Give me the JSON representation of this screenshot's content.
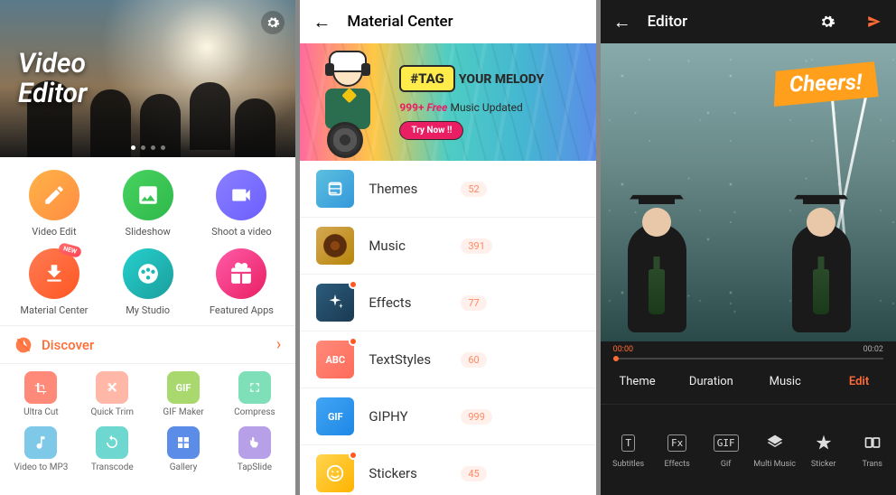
{
  "screen1": {
    "hero_title": "Video\nEditor",
    "main_items": [
      {
        "label": "Video Edit",
        "color": "c-orange",
        "icon": "pencil"
      },
      {
        "label": "Slideshow",
        "color": "c-green",
        "icon": "image"
      },
      {
        "label": "Shoot a video",
        "color": "c-purple",
        "icon": "camera"
      },
      {
        "label": "Material Center",
        "color": "c-red",
        "icon": "download",
        "badge": "NEW"
      },
      {
        "label": "My Studio",
        "color": "c-teal",
        "icon": "film"
      },
      {
        "label": "Featured Apps",
        "color": "c-pink",
        "icon": "gift"
      }
    ],
    "discover_label": "Discover",
    "tools": [
      {
        "label": "Ultra Cut",
        "color": "s-coral",
        "icon": "crop"
      },
      {
        "label": "Quick Trim",
        "color": "s-salmon",
        "icon": "scissors"
      },
      {
        "label": "GIF Maker",
        "color": "s-lime",
        "text": "GIF"
      },
      {
        "label": "Compress",
        "color": "s-mint",
        "icon": "compress"
      },
      {
        "label": "Video to MP3",
        "color": "s-sky",
        "icon": "music"
      },
      {
        "label": "Transcode",
        "color": "s-cyan",
        "icon": "refresh"
      },
      {
        "label": "Gallery",
        "color": "s-royal",
        "icon": "gallery"
      },
      {
        "label": "TapSlide",
        "color": "s-violet",
        "icon": "tap"
      }
    ]
  },
  "screen2": {
    "title": "Material Center",
    "banner": {
      "tag": "#TAG",
      "tagline": "YOUR MELODY",
      "count": "999+",
      "free": "Free",
      "suffix": "Music Updated",
      "cta": "Try Now !!"
    },
    "items": [
      {
        "name": "Themes",
        "count": "52",
        "thumb": "mt-teal",
        "icon": "theme"
      },
      {
        "name": "Music",
        "count": "391",
        "thumb": "mt-gold",
        "icon": "vinyl"
      },
      {
        "name": "Effects",
        "count": "77",
        "thumb": "mt-navy",
        "icon": "sparkle",
        "dot": true
      },
      {
        "name": "TextStyles",
        "count": "60",
        "thumb": "mt-coral",
        "text": "ABC",
        "dot": true
      },
      {
        "name": "GIPHY",
        "count": "999",
        "thumb": "mt-blue",
        "text": "GIF"
      },
      {
        "name": "Stickers",
        "count": "45",
        "thumb": "mt-yellow",
        "icon": "smile",
        "dot": true
      }
    ]
  },
  "screen3": {
    "title": "Editor",
    "cheers": "Cheers!",
    "time_current": "00:00",
    "time_total": "00:02",
    "tabs": [
      {
        "label": "Theme"
      },
      {
        "label": "Duration"
      },
      {
        "label": "Music"
      },
      {
        "label": "Edit",
        "active": true
      }
    ],
    "tools": [
      {
        "label": "Subtitles",
        "glyph": "T"
      },
      {
        "label": "Effects",
        "glyph": "Fx"
      },
      {
        "label": "Gif",
        "glyph": "GIF"
      },
      {
        "label": "Multi Music",
        "icon": "layers"
      },
      {
        "label": "Sticker",
        "icon": "star"
      },
      {
        "label": "Trans",
        "icon": "trans"
      }
    ]
  }
}
